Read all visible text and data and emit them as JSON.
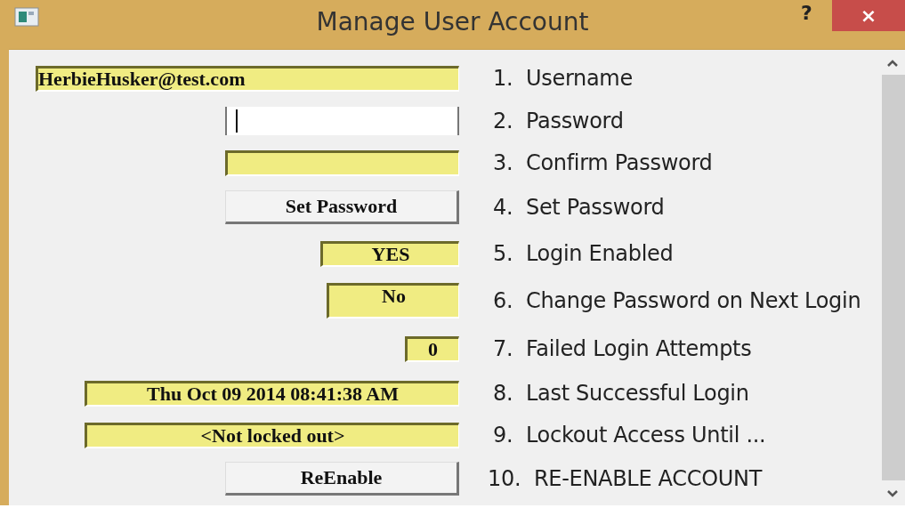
{
  "window": {
    "title": "Manage User Account",
    "help": "?",
    "close": "×"
  },
  "rows": [
    {
      "kind": "field",
      "value": "HerbieHusker@test.com",
      "label": "1.  Username"
    },
    {
      "kind": "input",
      "focused": true,
      "label": "2.  Password"
    },
    {
      "kind": "field",
      "label": "3.  Confirm Password"
    },
    {
      "kind": "button",
      "value": "Set Password",
      "label": "4.  Set Password"
    },
    {
      "kind": "field",
      "value": "YES",
      "label": "5.  Login Enabled"
    },
    {
      "kind": "field",
      "value": "No",
      "label": "6.  Change Password on Next Login"
    },
    {
      "kind": "field",
      "value": "0",
      "label": "7.  Failed Login Attempts"
    },
    {
      "kind": "field",
      "value": "Thu Oct 09 2014 08:41:38 AM",
      "label": "8.  Last Successful Login"
    },
    {
      "kind": "field",
      "value": "<Not locked out>",
      "label": "9.  Lockout Access Until ..."
    },
    {
      "kind": "button",
      "value": "ReEnable",
      "label": "10.  RE-ENABLE ACCOUNT"
    }
  ]
}
